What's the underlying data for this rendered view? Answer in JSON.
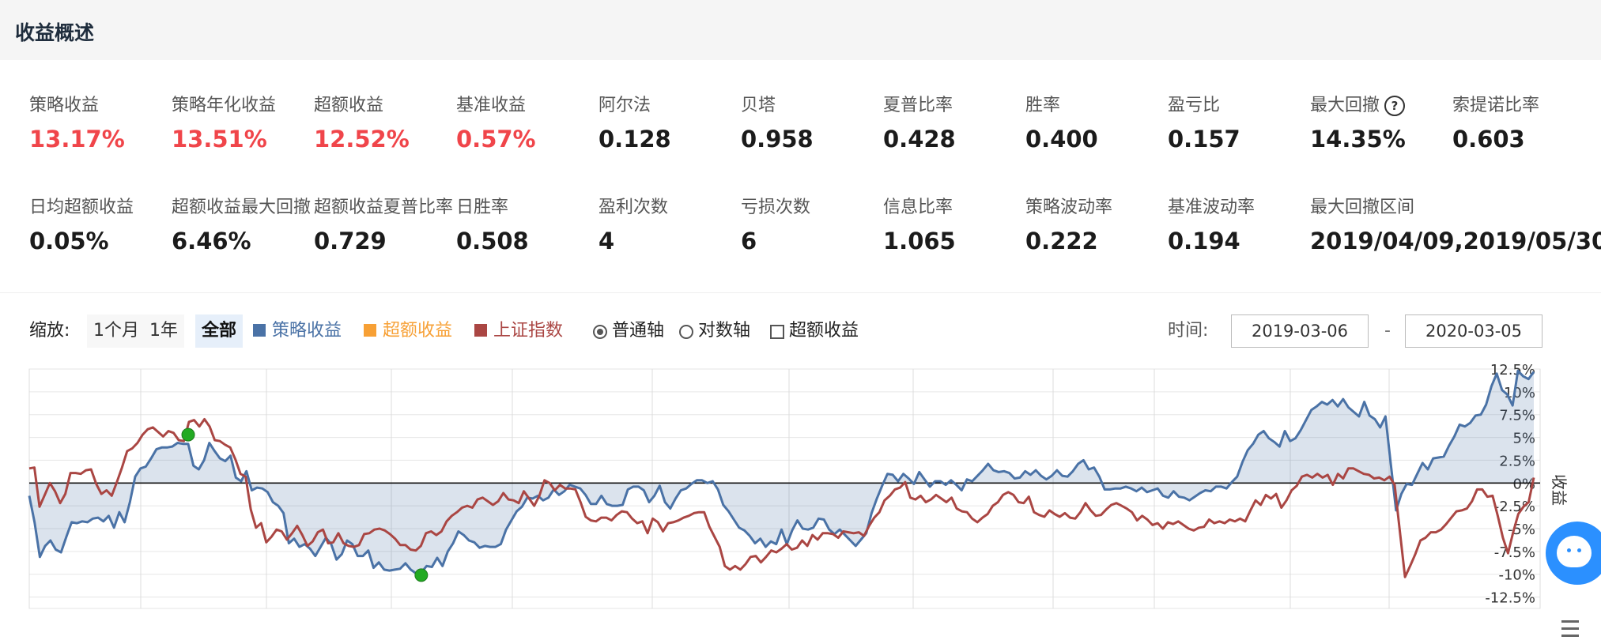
{
  "page_title": "收益概述",
  "metrics_row1": [
    {
      "label": "策略收益",
      "value": "13.17%",
      "color": "red"
    },
    {
      "label": "策略年化收益",
      "value": "13.51%",
      "color": "red"
    },
    {
      "label": "超额收益",
      "value": "12.52%",
      "color": "red"
    },
    {
      "label": "基准收益",
      "value": "0.57%",
      "color": "red"
    },
    {
      "label": "阿尔法",
      "value": "0.128",
      "color": "dark"
    },
    {
      "label": "贝塔",
      "value": "0.958",
      "color": "dark"
    },
    {
      "label": "夏普比率",
      "value": "0.428",
      "color": "dark"
    },
    {
      "label": "胜率",
      "value": "0.400",
      "color": "dark"
    },
    {
      "label": "盈亏比",
      "value": "0.157",
      "color": "dark"
    },
    {
      "label": "最大回撤",
      "value": "14.35%",
      "color": "dark",
      "help_icon": "question-circle-icon",
      "help_glyph": "?"
    },
    {
      "label": "索提诺比率",
      "value": "0.603",
      "color": "dark"
    }
  ],
  "metrics_row2": [
    {
      "label": "日均超额收益",
      "value": "0.05%"
    },
    {
      "label": "超额收益最大回撤",
      "value": "6.46%"
    },
    {
      "label": "超额收益夏普比率",
      "value": "0.729"
    },
    {
      "label": "日胜率",
      "value": "0.508"
    },
    {
      "label": "盈利次数",
      "value": "4"
    },
    {
      "label": "亏损次数",
      "value": "6"
    },
    {
      "label": "信息比率",
      "value": "1.065"
    },
    {
      "label": "策略波动率",
      "value": "0.222"
    },
    {
      "label": "基准波动率",
      "value": "0.194"
    },
    {
      "label": "最大回撤区间",
      "value": "2019/04/09,2019/05/30"
    }
  ],
  "toolbar": {
    "zoom_label": "缩放:",
    "zoom_options": [
      "1个月",
      "1年",
      "全部"
    ],
    "zoom_active": "全部",
    "legend": [
      {
        "name": "策略收益",
        "color": "#4a72a6"
      },
      {
        "name": "超额收益",
        "color": "#f7a035"
      },
      {
        "name": "上证指数",
        "color": "#aa4643"
      }
    ],
    "axis_options": [
      {
        "label": "普通轴",
        "type": "radio",
        "checked": true
      },
      {
        "label": "对数轴",
        "type": "radio",
        "checked": false
      },
      {
        "label": "超额收益",
        "type": "checkbox",
        "checked": false
      }
    ],
    "time_label": "时间:",
    "date_start": "2019-03-06",
    "date_sep": "-",
    "date_end": "2020-03-05"
  },
  "chart_data": {
    "type": "line",
    "ylabel": "收益",
    "ylim": [
      -12.5,
      12.5
    ],
    "y_ticks": [
      "12.5%",
      "10%",
      "7.5%",
      "5%",
      "2.5%",
      "0%",
      "-2.5%",
      "-5%",
      "-7.5%",
      "-10%",
      "-12.5%"
    ],
    "series": [
      {
        "name": "策略收益",
        "color": "#4a72a6",
        "area": true,
        "values": [
          -1.4,
          -4.3,
          -8.1,
          -6.9,
          -6.3,
          -7.3,
          -7.6,
          -5.9,
          -4.3,
          -4.4,
          -4.2,
          -4.3,
          -3.9,
          -3.8,
          -4.2,
          -3.6,
          -4.9,
          -3.2,
          -4.3,
          -2.1,
          0.7,
          1.6,
          1.8,
          2.7,
          3.7,
          3.9,
          3.9,
          4.0,
          4.4,
          4.3,
          4.3,
          1.9,
          1.5,
          2.5,
          4.4,
          3.5,
          2.7,
          2.4,
          3.0,
          0.6,
          0.2,
          1.3,
          -0.8,
          -0.5,
          -0.6,
          -1.0,
          -2.1,
          -2.5,
          -3.3,
          -6.6,
          -6.1,
          -7.0,
          -6.7,
          -7.2,
          -8.0,
          -7.0,
          -6.0,
          -6.7,
          -8.4,
          -7.8,
          -6.3,
          -6.7,
          -8.0,
          -8.0,
          -7.4,
          -9.3,
          -8.7,
          -9.5,
          -9.6,
          -9.5,
          -9.4,
          -8.8,
          -9.5,
          -9.9,
          -9.8,
          -9.1,
          -9.2,
          -8.2,
          -9.1,
          -7.5,
          -6.6,
          -5.3,
          -5.7,
          -6.3,
          -6.5,
          -7.1,
          -6.9,
          -7.0,
          -7.0,
          -6.7,
          -5.1,
          -4.1,
          -3.1,
          -2.6,
          -1.6,
          -1.7,
          -1.4,
          -1.9,
          -1.6,
          -0.7,
          -1.3,
          -0.9,
          -0.2,
          -0.4,
          -0.6,
          -1.3,
          -2.3,
          -2.3,
          -1.4,
          -2.3,
          -2.5,
          -2.5,
          -2.4,
          -0.7,
          -0.4,
          -0.4,
          -0.8,
          -2.1,
          -1.4,
          -0.3,
          -2.1,
          -2.8,
          -1.7,
          -0.8,
          -0.6,
          -0.1,
          0.3,
          0.3,
          0.0,
          0.2,
          -0.7,
          -2.4,
          -3.1,
          -4.0,
          -4.9,
          -5.2,
          -5.8,
          -6.6,
          -6.1,
          -7.0,
          -6.4,
          -6.7,
          -5.1,
          -6.7,
          -5.2,
          -4.1,
          -5.0,
          -5.1,
          -4.9,
          -3.9,
          -4.0,
          -5.1,
          -5.6,
          -5.1,
          -5.7,
          -6.3,
          -6.9,
          -6.2,
          -5.5,
          -3.3,
          -1.7,
          -0.3,
          1.0,
          0.9,
          0.2,
          1.0,
          0.5,
          -0.1,
          1.2,
          0.4,
          -0.4,
          0.2,
          0.2,
          -0.2,
          0.3,
          -0.2,
          -0.8,
          0.4,
          0.2,
          0.8,
          1.4,
          2.1,
          1.4,
          1.2,
          1.3,
          1.1,
          0.5,
          0.6,
          1.3,
          0.9,
          1.4,
          0.8,
          0.4,
          0.8,
          1.4,
          0.8,
          0.7,
          1.3,
          2.1,
          2.5,
          1.5,
          1.7,
          0.7,
          -0.7,
          -0.7,
          -0.6,
          -0.6,
          -0.4,
          -0.6,
          -0.9,
          -0.5,
          -1.0,
          -0.8,
          -0.6,
          -1.4,
          -1.6,
          -0.9,
          -1.5,
          -1.6,
          -1.9,
          -1.5,
          -1.1,
          -0.8,
          -0.9,
          -0.4,
          -0.4,
          -0.6,
          0.1,
          0.7,
          2.3,
          3.6,
          4.3,
          5.3,
          5.7,
          4.9,
          4.5,
          4.0,
          5.7,
          4.6,
          4.9,
          5.8,
          6.9,
          8.0,
          8.4,
          8.9,
          8.6,
          9.1,
          8.4,
          9.2,
          8.3,
          7.8,
          7.3,
          8.9,
          7.4,
          7.0,
          6.1,
          7.3,
          2.1,
          -3.0,
          -1.2,
          -0.1,
          -0.2,
          1.0,
          2.2,
          1.5,
          2.7,
          2.8,
          2.9,
          4.1,
          5.1,
          6.4,
          6.2,
          6.6,
          7.4,
          7.5,
          8.6,
          10.6,
          12.0,
          10.2,
          9.7,
          8.5,
          12.3,
          11.7,
          11.4,
          12.2
        ]
      },
      {
        "name": "上证指数",
        "color": "#aa4643",
        "area": false,
        "values": [
          1.6,
          1.7,
          -2.6,
          -1.3,
          0.0,
          -0.9,
          -2.2,
          -1.2,
          1.1,
          1.1,
          1.0,
          1.4,
          1.5,
          -0.1,
          -1.2,
          -0.8,
          -1.4,
          0.1,
          1.7,
          3.5,
          3.8,
          4.4,
          5.3,
          5.9,
          6.1,
          5.6,
          5.1,
          5.7,
          5.5,
          4.7,
          4.6,
          6.7,
          6.9,
          6.2,
          7.0,
          6.2,
          4.7,
          4.6,
          4.2,
          3.9,
          2.6,
          1.0,
          0.7,
          -2.9,
          -4.9,
          -4.4,
          -6.5,
          -5.9,
          -5.1,
          -5.3,
          -6.2,
          -5.5,
          -4.7,
          -5.7,
          -6.9,
          -6.4,
          -5.4,
          -5.1,
          -6.6,
          -6.5,
          -5.5,
          -6.6,
          -6.9,
          -7.0,
          -6.8,
          -5.6,
          -5.5,
          -5.1,
          -5.0,
          -5.2,
          -5.6,
          -6.1,
          -6.8,
          -6.8,
          -7.3,
          -7.4,
          -6.9,
          -5.5,
          -5.3,
          -5.7,
          -5.3,
          -4.2,
          -3.6,
          -3.2,
          -2.7,
          -2.5,
          -2.7,
          -1.8,
          -1.6,
          -2.0,
          -2.4,
          -2.0,
          -1.1,
          -1.8,
          -1.9,
          -2.2,
          -0.9,
          -1.7,
          -2.5,
          -1.4,
          0.3,
          0.0,
          -0.8,
          -0.2,
          -0.6,
          -0.6,
          -0.7,
          -2.1,
          -3.7,
          -4.1,
          -4.2,
          -3.8,
          -3.8,
          -4.1,
          -3.5,
          -3.1,
          -3.2,
          -3.9,
          -4.4,
          -4.2,
          -5.5,
          -3.9,
          -4.3,
          -5.3,
          -4.4,
          -4.3,
          -4.1,
          -3.8,
          -3.6,
          -3.3,
          -3.2,
          -3.2,
          -4.8,
          -5.9,
          -7.0,
          -9.1,
          -9.5,
          -9.1,
          -9.5,
          -8.9,
          -8.1,
          -8.0,
          -8.7,
          -8.1,
          -7.4,
          -7.6,
          -7.2,
          -6.7,
          -7.3,
          -7.1,
          -6.3,
          -6.9,
          -5.7,
          -6.2,
          -5.5,
          -5.5,
          -5.6,
          -6.0,
          -5.3,
          -5.4,
          -5.5,
          -5.4,
          -5.8,
          -4.7,
          -3.8,
          -3.2,
          -1.9,
          -1.4,
          -0.7,
          -0.5,
          0.1,
          -1.6,
          -1.8,
          -1.4,
          -2.1,
          -1.8,
          -1.3,
          -1.7,
          -2.1,
          -1.6,
          -2.8,
          -3.1,
          -3.2,
          -3.9,
          -4.3,
          -3.8,
          -3.4,
          -2.5,
          -2.1,
          -1.3,
          -1.0,
          -1.3,
          -2.1,
          -2.2,
          -1.5,
          -3.2,
          -3.5,
          -3.7,
          -3.0,
          -3.4,
          -3.7,
          -3.3,
          -3.8,
          -3.9,
          -3.2,
          -2.2,
          -3.0,
          -3.6,
          -3.5,
          -2.9,
          -2.4,
          -2.2,
          -2.5,
          -2.8,
          -3.2,
          -4.1,
          -3.6,
          -4.0,
          -4.6,
          -4.4,
          -5.0,
          -4.3,
          -4.5,
          -4.2,
          -4.6,
          -5.0,
          -5.2,
          -4.9,
          -4.8,
          -4.0,
          -4.4,
          -4.2,
          -4.4,
          -4.0,
          -4.2,
          -3.9,
          -4.2,
          -3.0,
          -1.9,
          -2.4,
          -1.3,
          -1.7,
          -1.2,
          -2.7,
          -1.9,
          -0.8,
          -0.3,
          0.7,
          0.9,
          0.6,
          1.0,
          0.6,
          0.9,
          -0.2,
          1.0,
          0.5,
          1.6,
          1.6,
          1.3,
          1.0,
          0.9,
          0.5,
          0.6,
          0.3,
          0.7,
          -0.2,
          -5.3,
          -10.3,
          -9.1,
          -7.8,
          -6.3,
          -6.0,
          -5.4,
          -5.4,
          -5.1,
          -4.5,
          -3.8,
          -3.1,
          -3.0,
          -2.8,
          -2.0,
          -0.7,
          -0.7,
          -1.5,
          -1.4,
          -3.6,
          -6.0,
          -7.7,
          -5.4,
          -3.4,
          -2.6,
          -2.1,
          0.6
        ]
      }
    ],
    "markers": [
      {
        "series": "策略收益",
        "index": 30,
        "value": 5.3,
        "color": "#22aa22"
      },
      {
        "series": "策略收益",
        "index": 74,
        "value": -10.1,
        "color": "#22aa22"
      }
    ],
    "grid": true,
    "x_gridlines": 12
  },
  "assistant_button_icon": "customer-service-icon",
  "menu_icon": "list-icon"
}
